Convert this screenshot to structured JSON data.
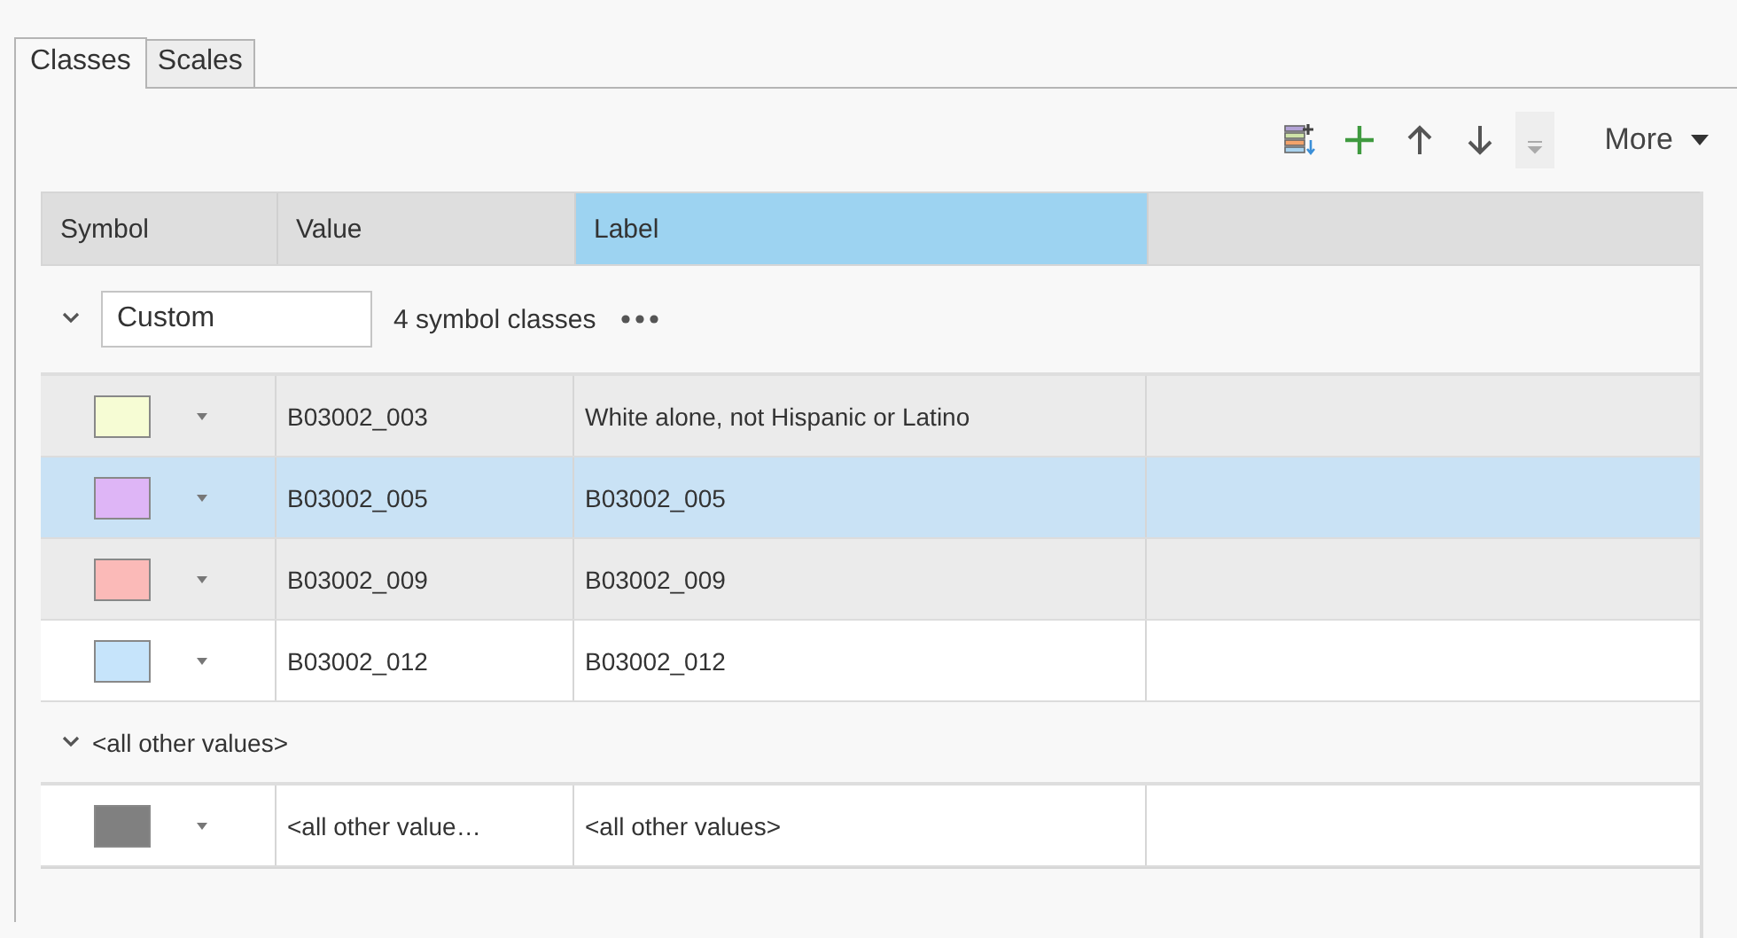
{
  "tabs": [
    {
      "label": "Classes",
      "selected": true
    },
    {
      "label": "Scales",
      "selected": false
    }
  ],
  "toolbar": {
    "more_label": "More"
  },
  "table": {
    "columns": [
      {
        "label": "Symbol",
        "selected": false
      },
      {
        "label": "Value",
        "selected": false
      },
      {
        "label": "Label",
        "selected": true
      }
    ],
    "groups": [
      {
        "kind": "custom",
        "expanded": true,
        "heading": "Custom",
        "count": "4 symbol classes",
        "rows": [
          {
            "color": "#f6fcd4",
            "value": "B03002_003",
            "label": "White alone, not Hispanic or Latino",
            "selected": false
          },
          {
            "color": "#deb5f6",
            "value": "B03002_005",
            "label": "B03002_005",
            "selected": true
          },
          {
            "color": "#fbbab8",
            "value": "B03002_009",
            "label": "B03002_009",
            "selected": false
          },
          {
            "color": "#c6e4fb",
            "value": "B03002_012",
            "label": "B03002_012",
            "selected": false
          }
        ]
      },
      {
        "kind": "other",
        "expanded": true,
        "heading": "<all other values>",
        "rows": [
          {
            "color": "#808080",
            "value": "<all other value…",
            "label": "<all other values>",
            "selected": false
          }
        ]
      }
    ]
  }
}
